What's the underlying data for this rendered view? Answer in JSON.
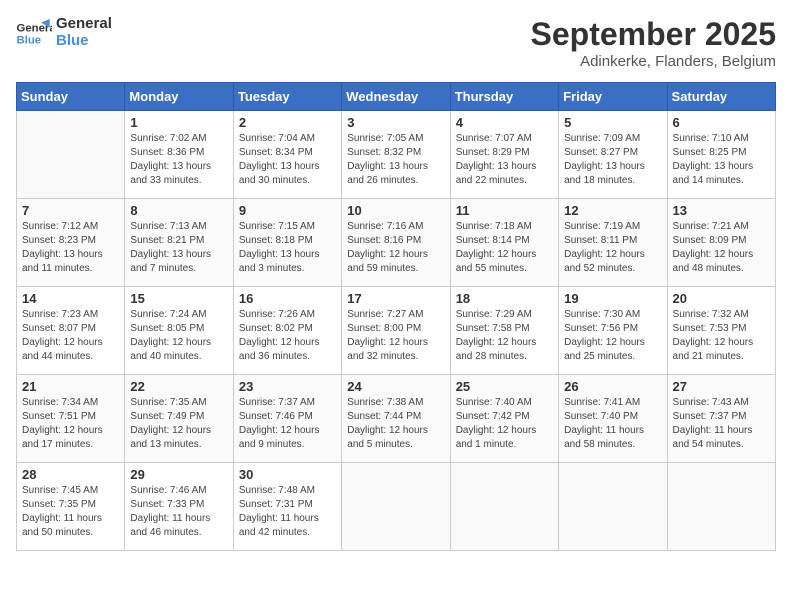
{
  "header": {
    "logo_line1": "General",
    "logo_line2": "Blue",
    "month": "September 2025",
    "location": "Adinkerke, Flanders, Belgium"
  },
  "days_of_week": [
    "Sunday",
    "Monday",
    "Tuesday",
    "Wednesday",
    "Thursday",
    "Friday",
    "Saturday"
  ],
  "weeks": [
    [
      {
        "day": "",
        "sunrise": "",
        "sunset": "",
        "daylight": ""
      },
      {
        "day": "1",
        "sunrise": "7:02 AM",
        "sunset": "8:36 PM",
        "daylight": "13 hours and 33 minutes."
      },
      {
        "day": "2",
        "sunrise": "7:04 AM",
        "sunset": "8:34 PM",
        "daylight": "13 hours and 30 minutes."
      },
      {
        "day": "3",
        "sunrise": "7:05 AM",
        "sunset": "8:32 PM",
        "daylight": "13 hours and 26 minutes."
      },
      {
        "day": "4",
        "sunrise": "7:07 AM",
        "sunset": "8:29 PM",
        "daylight": "13 hours and 22 minutes."
      },
      {
        "day": "5",
        "sunrise": "7:09 AM",
        "sunset": "8:27 PM",
        "daylight": "13 hours and 18 minutes."
      },
      {
        "day": "6",
        "sunrise": "7:10 AM",
        "sunset": "8:25 PM",
        "daylight": "13 hours and 14 minutes."
      }
    ],
    [
      {
        "day": "7",
        "sunrise": "7:12 AM",
        "sunset": "8:23 PM",
        "daylight": "13 hours and 11 minutes."
      },
      {
        "day": "8",
        "sunrise": "7:13 AM",
        "sunset": "8:21 PM",
        "daylight": "13 hours and 7 minutes."
      },
      {
        "day": "9",
        "sunrise": "7:15 AM",
        "sunset": "8:18 PM",
        "daylight": "13 hours and 3 minutes."
      },
      {
        "day": "10",
        "sunrise": "7:16 AM",
        "sunset": "8:16 PM",
        "daylight": "12 hours and 59 minutes."
      },
      {
        "day": "11",
        "sunrise": "7:18 AM",
        "sunset": "8:14 PM",
        "daylight": "12 hours and 55 minutes."
      },
      {
        "day": "12",
        "sunrise": "7:19 AM",
        "sunset": "8:11 PM",
        "daylight": "12 hours and 52 minutes."
      },
      {
        "day": "13",
        "sunrise": "7:21 AM",
        "sunset": "8:09 PM",
        "daylight": "12 hours and 48 minutes."
      }
    ],
    [
      {
        "day": "14",
        "sunrise": "7:23 AM",
        "sunset": "8:07 PM",
        "daylight": "12 hours and 44 minutes."
      },
      {
        "day": "15",
        "sunrise": "7:24 AM",
        "sunset": "8:05 PM",
        "daylight": "12 hours and 40 minutes."
      },
      {
        "day": "16",
        "sunrise": "7:26 AM",
        "sunset": "8:02 PM",
        "daylight": "12 hours and 36 minutes."
      },
      {
        "day": "17",
        "sunrise": "7:27 AM",
        "sunset": "8:00 PM",
        "daylight": "12 hours and 32 minutes."
      },
      {
        "day": "18",
        "sunrise": "7:29 AM",
        "sunset": "7:58 PM",
        "daylight": "12 hours and 28 minutes."
      },
      {
        "day": "19",
        "sunrise": "7:30 AM",
        "sunset": "7:56 PM",
        "daylight": "12 hours and 25 minutes."
      },
      {
        "day": "20",
        "sunrise": "7:32 AM",
        "sunset": "7:53 PM",
        "daylight": "12 hours and 21 minutes."
      }
    ],
    [
      {
        "day": "21",
        "sunrise": "7:34 AM",
        "sunset": "7:51 PM",
        "daylight": "12 hours and 17 minutes."
      },
      {
        "day": "22",
        "sunrise": "7:35 AM",
        "sunset": "7:49 PM",
        "daylight": "12 hours and 13 minutes."
      },
      {
        "day": "23",
        "sunrise": "7:37 AM",
        "sunset": "7:46 PM",
        "daylight": "12 hours and 9 minutes."
      },
      {
        "day": "24",
        "sunrise": "7:38 AM",
        "sunset": "7:44 PM",
        "daylight": "12 hours and 5 minutes."
      },
      {
        "day": "25",
        "sunrise": "7:40 AM",
        "sunset": "7:42 PM",
        "daylight": "12 hours and 1 minute."
      },
      {
        "day": "26",
        "sunrise": "7:41 AM",
        "sunset": "7:40 PM",
        "daylight": "11 hours and 58 minutes."
      },
      {
        "day": "27",
        "sunrise": "7:43 AM",
        "sunset": "7:37 PM",
        "daylight": "11 hours and 54 minutes."
      }
    ],
    [
      {
        "day": "28",
        "sunrise": "7:45 AM",
        "sunset": "7:35 PM",
        "daylight": "11 hours and 50 minutes."
      },
      {
        "day": "29",
        "sunrise": "7:46 AM",
        "sunset": "7:33 PM",
        "daylight": "11 hours and 46 minutes."
      },
      {
        "day": "30",
        "sunrise": "7:48 AM",
        "sunset": "7:31 PM",
        "daylight": "11 hours and 42 minutes."
      },
      {
        "day": "",
        "sunrise": "",
        "sunset": "",
        "daylight": ""
      },
      {
        "day": "",
        "sunrise": "",
        "sunset": "",
        "daylight": ""
      },
      {
        "day": "",
        "sunrise": "",
        "sunset": "",
        "daylight": ""
      },
      {
        "day": "",
        "sunrise": "",
        "sunset": "",
        "daylight": ""
      }
    ]
  ],
  "labels": {
    "sunrise": "Sunrise:",
    "sunset": "Sunset:",
    "daylight": "Daylight:"
  }
}
